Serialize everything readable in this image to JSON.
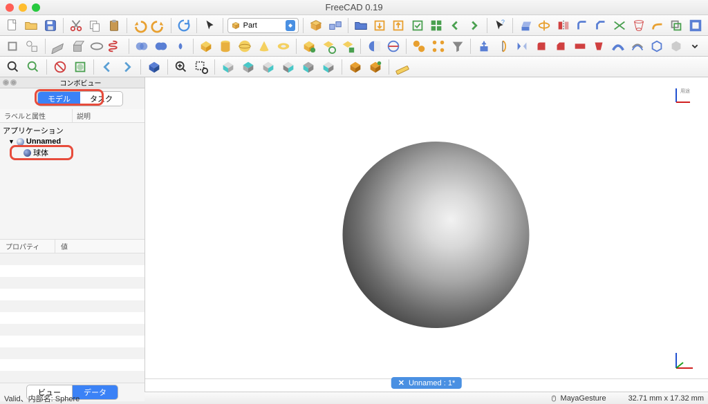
{
  "app": {
    "title": "FreeCAD 0.19"
  },
  "workbench": {
    "selected": "Part",
    "icon": "part-icon"
  },
  "toolbar_row1_icons": [
    "new-file-icon",
    "open-file-icon",
    "save-icon",
    "sep",
    "cut-icon",
    "copy-icon",
    "paste-icon",
    "sep",
    "undo-icon",
    "redo-icon",
    "sep",
    "refresh-icon",
    "sep",
    "cursor-icon",
    "sep",
    "workbench-select",
    "sep",
    "link-make-icon",
    "link-actions-icon",
    "sep",
    "group-open-icon",
    "link-import-icon",
    "link-export-icon",
    "link-select-icon",
    "link-all-icon",
    "nav-back-icon",
    "nav-fwd-icon",
    "sep",
    "whatsthis-icon",
    "sep",
    "extrude-icon",
    "revolve-icon",
    "mirror-icon",
    "fillet-icon",
    "chamfer-icon",
    "ruled-icon",
    "loft-icon",
    "sweep-icon",
    "offset3d-icon",
    "thickness-icon"
  ],
  "toolbar_row2_icons": [
    "part-box-build-icon",
    "part-shapebuild-icon",
    "sep",
    "part-plane-icon",
    "part-box2-icon",
    "part-ellipse-icon",
    "part-helix-icon",
    "sep",
    "boolean-icon",
    "fuse-icon",
    "common-icon",
    "sep",
    "part-cube-icon",
    "part-cylinder-icon",
    "part-sphere-icon",
    "part-cone-icon",
    "part-torus-icon",
    "sep",
    "part-prism-icon",
    "part-wedge-icon",
    "part-tube-icon",
    "sep",
    "section-icon",
    "cross-icon",
    "sep",
    "compound-icon",
    "explode-icon",
    "filter-icon",
    "sep",
    "extrude2-icon",
    "revolve2-icon",
    "mirror2-icon",
    "fillet2-icon",
    "chamfer2-icon",
    "ruled2-icon",
    "loft2-icon",
    "sweep2-icon",
    "offset2-icon",
    "thickness2-icon",
    "projection-icon",
    "expand-icon"
  ],
  "toolbar_row3_icons": [
    "fit-all-icon",
    "fit-selection-icon",
    "sep",
    "draw-style-icon",
    "bbox-icon",
    "sep",
    "nav-left-icon",
    "nav-right-icon",
    "sep",
    "isometric-icon",
    "sep",
    "zoom-in-icon",
    "zoom-box-icon",
    "sep",
    "front-icon",
    "top-icon",
    "right-icon",
    "rear-icon",
    "bottom-icon",
    "left-icon",
    "sep",
    "iso2-icon",
    "iso3-icon",
    "sep",
    "measure-icon"
  ],
  "panel": {
    "combo_title": "コンボビュー",
    "tabs": {
      "model": "モデル",
      "task": "タスク",
      "active": "model"
    },
    "tree_headers": {
      "label": "ラベルと属性",
      "desc": "説明"
    },
    "tree": {
      "root": "アプリケーション",
      "doc": "Unnamed",
      "item": "球体"
    },
    "prop_headers": {
      "property": "プロパティ",
      "value": "値"
    },
    "bottom_tabs": {
      "view": "ビュー",
      "data": "データ",
      "active": "data"
    }
  },
  "viewport": {
    "doc_tab": "Unnamed : 1*",
    "axis_label": "用途"
  },
  "status": {
    "message": "Valid、内部名: Sphere",
    "nav_style": "MayaGesture",
    "dimensions": "32.71 mm x 17.32 mm"
  },
  "colors": {
    "accent": "#3b82f6",
    "highlight": "#e74c3c"
  }
}
